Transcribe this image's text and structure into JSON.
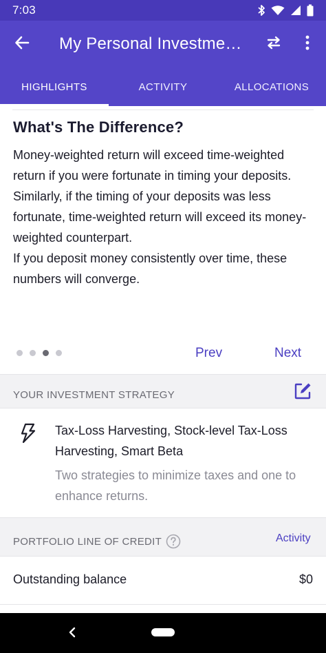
{
  "status_bar": {
    "time": "7:03",
    "icons": [
      "bluetooth-icon",
      "wifi-icon",
      "signal-icon",
      "battery-icon"
    ]
  },
  "app_bar": {
    "title": "My Personal Investme…",
    "icons": [
      "back-arrow-icon",
      "swap-icon",
      "more-vert-icon"
    ]
  },
  "tabs": [
    {
      "label": "HIGHLIGHTS",
      "active": true
    },
    {
      "label": "ACTIVITY",
      "active": false
    },
    {
      "label": "ALLOCATIONS",
      "active": false
    }
  ],
  "highlight_card": {
    "title": "What's The Difference?",
    "paragraphs": [
      "Money-weighted return will exceed time-weighted return if you were fortunate in timing your deposits. Similarly, if the timing of your deposits was less fortunate, time-weighted return will exceed its money-weighted counterpart.",
      "If you deposit money consistently over time, these numbers will converge."
    ],
    "page_count": 4,
    "current_page": 3,
    "prev_label": "Prev",
    "next_label": "Next"
  },
  "strategy": {
    "header": "YOUR INVESTMENT STRATEGY",
    "edit_icon": "edit-icon",
    "icon": "lightning-icon",
    "title": "Tax-Loss Harvesting, Stock-level Tax-Loss Harvesting, Smart Beta",
    "description": "Two strategies to minimize taxes and one to enhance returns."
  },
  "credit": {
    "header": "PORTFOLIO LINE OF CREDIT",
    "help_icon": "help-circle-icon",
    "activity_link": "Activity",
    "balance_label": "Outstanding balance",
    "balance_value": "$0"
  },
  "nav_bar": {
    "icons": [
      "nav-back-icon",
      "home-pill-icon"
    ]
  },
  "colors": {
    "status_bar": "#4839b8",
    "app_bar": "#5445c8",
    "accent": "#4b3fc2",
    "section_bg": "#f2f2f4"
  }
}
